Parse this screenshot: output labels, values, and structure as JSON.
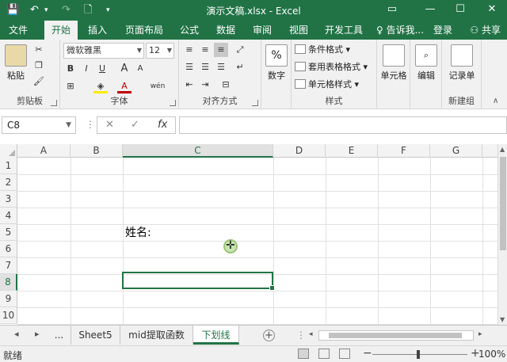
{
  "window": {
    "title": "演示文稿.xlsx - Excel",
    "quick_access": {
      "save": "💾",
      "undo": "↶",
      "redo": "↷",
      "new": "🗋",
      "customize": "▾"
    },
    "controls": {
      "ribbon_options": "▭",
      "minimize": "—",
      "maximize": "☐",
      "close": "✕"
    }
  },
  "menu": {
    "tabs": [
      "文件",
      "开始",
      "插入",
      "页面布局",
      "公式",
      "数据",
      "审阅",
      "视图",
      "开发工具"
    ],
    "active_tab": "开始",
    "tell_me": "告诉我...",
    "login": "登录",
    "share": "共享"
  },
  "ribbon": {
    "clipboard": {
      "label": "剪贴板",
      "paste": "粘贴"
    },
    "font": {
      "label": "字体",
      "font_name": "微软雅黑",
      "font_size": "12",
      "bold": "B",
      "italic": "I",
      "underline": "U",
      "increase_size": "A",
      "decrease_size": "A",
      "font_color": "A",
      "phonetic": "wén"
    },
    "alignment": {
      "label": "对齐方式"
    },
    "number": {
      "label": "数字",
      "button": "数字",
      "percent_icon": "%"
    },
    "styles": {
      "label": "样式",
      "conditional": "条件格式",
      "table": "套用表格格式",
      "cell": "单元格样式"
    },
    "cells": {
      "button": "单元格"
    },
    "editing": {
      "button": "编辑"
    },
    "new_group": {
      "label": "新建组",
      "button": "记录单"
    }
  },
  "formula_bar": {
    "name_box": "C8",
    "cancel": "✕",
    "enter": "✓",
    "fx": "fx",
    "value": ""
  },
  "grid": {
    "columns": [
      "A",
      "B",
      "C",
      "D",
      "E",
      "F",
      "G"
    ],
    "rows": [
      "1",
      "2",
      "3",
      "4",
      "5",
      "6",
      "7",
      "8",
      "9",
      "10"
    ],
    "selected_cell": "C8",
    "cells": {
      "C5": "姓名:"
    }
  },
  "sheets": {
    "nav_prev": "◂",
    "nav_next": "▸",
    "ellipsis": "...",
    "tabs": [
      "Sheet5",
      "mid提取函数",
      "下划线"
    ],
    "active": "下划线",
    "add": "+"
  },
  "status": {
    "ready": "就绪",
    "zoom": "100%",
    "zoom_level": 100,
    "minus": "−",
    "plus": "+"
  },
  "colors": {
    "excel_green": "#217346",
    "ribbon_bg": "#f1f1f1"
  }
}
